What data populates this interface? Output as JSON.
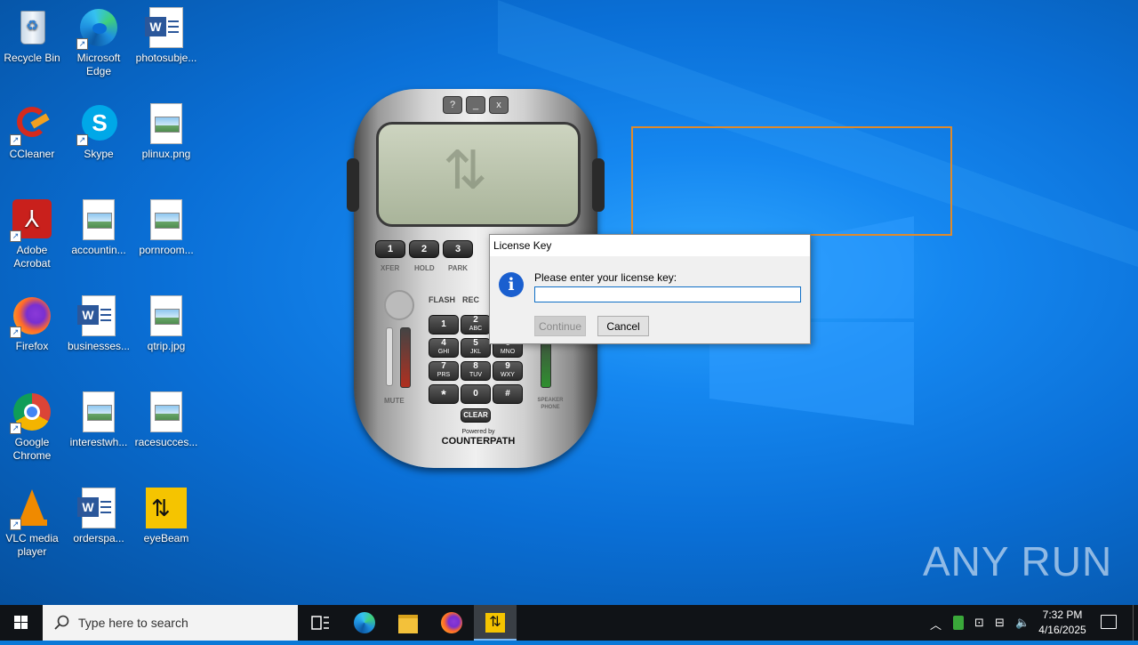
{
  "desktop": {
    "icons": [
      {
        "label": "Recycle Bin"
      },
      {
        "label": "Microsoft Edge"
      },
      {
        "label": "photosubje..."
      },
      {
        "label": "CCleaner"
      },
      {
        "label": "Skype"
      },
      {
        "label": "plinux.png"
      },
      {
        "label": "Adobe Acrobat"
      },
      {
        "label": "accountin..."
      },
      {
        "label": "pornroom..."
      },
      {
        "label": "Firefox"
      },
      {
        "label": "businesses..."
      },
      {
        "label": "qtrip.jpg"
      },
      {
        "label": "Google Chrome"
      },
      {
        "label": "interestwh..."
      },
      {
        "label": "racesucces..."
      },
      {
        "label": "VLC media player"
      },
      {
        "label": "orderspa..."
      },
      {
        "label": "eyeBeam"
      }
    ]
  },
  "phone": {
    "top_buttons": [
      "?",
      "_",
      "x"
    ],
    "line_keys": [
      "1",
      "2",
      "3"
    ],
    "function_labels": [
      "XFER",
      "HOLD",
      "PARK"
    ],
    "side_labels": [
      "FLASH",
      "REC"
    ],
    "keypad": [
      {
        "main": "1",
        "sub": ""
      },
      {
        "main": "2",
        "sub": "ABC"
      },
      {
        "main": "3",
        "sub": "DEF"
      },
      {
        "main": "4",
        "sub": "GHI"
      },
      {
        "main": "5",
        "sub": "JKL"
      },
      {
        "main": "6",
        "sub": "MNO"
      },
      {
        "main": "7",
        "sub": "PRS"
      },
      {
        "main": "8",
        "sub": "TUV"
      },
      {
        "main": "9",
        "sub": "WXY"
      },
      {
        "main": "*",
        "sub": ""
      },
      {
        "main": "0",
        "sub": ""
      },
      {
        "main": "#",
        "sub": ""
      }
    ],
    "clear_label": "CLEAR",
    "mute_label": "MUTE",
    "speaker_label": "SPEAKER PHONE",
    "powered_by": "Powered by",
    "brand": "COUNTERPATH"
  },
  "dialog": {
    "title": "License Key",
    "prompt": "Please enter your license key:",
    "input_value": "",
    "continue_label": "Continue",
    "cancel_label": "Cancel"
  },
  "watermark": "ANY RUN",
  "taskbar": {
    "search_placeholder": "Type here to search",
    "time": "7:32 PM",
    "date": "4/16/2025"
  },
  "colors": {
    "desktop": "#0a78d7",
    "accent": "#0f6fc6",
    "selection": "#e08a2a"
  }
}
